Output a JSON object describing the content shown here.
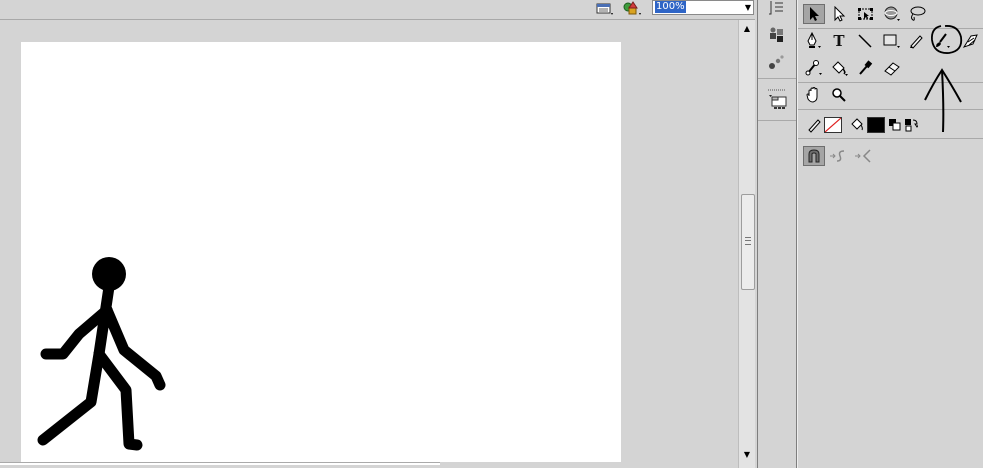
{
  "top_bar": {
    "zoom_value": "100%"
  },
  "colors": {
    "stroke_swatch": "#ffffff",
    "fill_swatch": "#000000",
    "zoom_highlight": "#2f65c6"
  },
  "icons": [
    "edit-scene-icon",
    "edit-symbol-icon",
    "zoom-dropdown-arrow-icon",
    "selection-tool-icon",
    "subselection-tool-icon",
    "free-transform-tool-icon",
    "3d-rotation-tool-icon",
    "lasso-tool-icon",
    "pen-tool-icon",
    "text-tool-icon",
    "line-tool-icon",
    "rectangle-tool-icon",
    "pencil-tool-icon",
    "brush-tool-icon",
    "deco-tool-icon",
    "bone-tool-icon",
    "paint-bucket-tool-icon",
    "eyedropper-tool-icon",
    "eraser-tool-icon",
    "hand-tool-icon",
    "zoom-tool-icon",
    "stroke-color-icon",
    "fill-color-icon",
    "black-white-icon",
    "swap-colors-icon",
    "snap-to-objects-icon",
    "smooth-icon",
    "straighten-icon"
  ]
}
